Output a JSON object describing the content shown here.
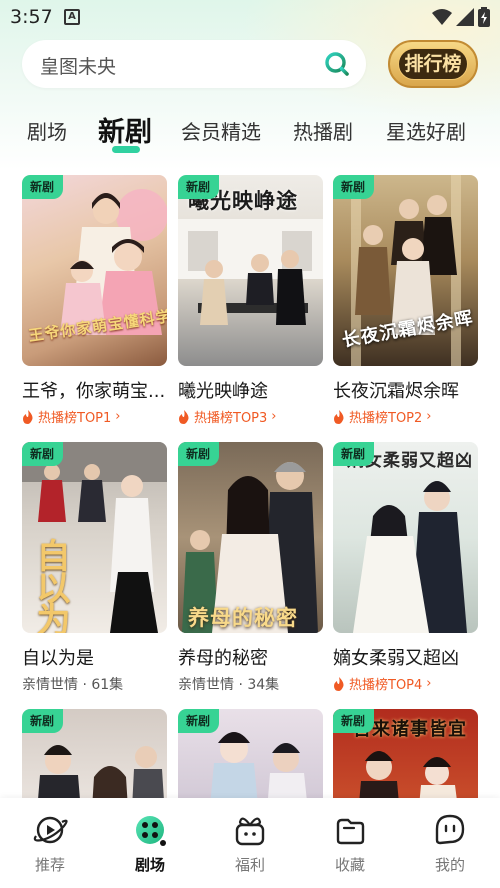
{
  "status_bar": {
    "time": "3:57",
    "notification_icon": "A"
  },
  "search": {
    "placeholder": "皇图未央"
  },
  "rank_button": {
    "label": "排行榜"
  },
  "tabs": [
    {
      "label": "剧场"
    },
    {
      "label": "新剧"
    },
    {
      "label": "会员精选"
    },
    {
      "label": "热播剧"
    },
    {
      "label": "星选好剧"
    }
  ],
  "colors": {
    "accent": "#30d1a0",
    "badge": "#37d394",
    "hot": "#f05a24"
  },
  "cards": [
    {
      "badge": "新剧",
      "poster_text": "王爷你家萌宝懂科学",
      "title": "王爷，你家萌宝...",
      "hot": "热播榜TOP1"
    },
    {
      "badge": "新剧",
      "poster_text": "曦光映峥途",
      "title": "曦光映峥途",
      "hot": "热播榜TOP3"
    },
    {
      "badge": "新剧",
      "poster_text": "长夜沉霜烬余晖",
      "title": "长夜沉霜烬余晖",
      "hot": "热播榜TOP2"
    },
    {
      "badge": "新剧",
      "poster_text": "自以为是",
      "title": "自以为是",
      "sub": "亲情世情 · 61集"
    },
    {
      "badge": "新剧",
      "poster_text": "养母的秘密",
      "title": "养母的秘密",
      "sub": "亲情世情 · 34集"
    },
    {
      "badge": "新剧",
      "poster_text": "嫡女柔弱又超凶",
      "title": "嫡女柔弱又超凶",
      "hot": "热播榜TOP4"
    },
    {
      "badge": "新剧"
    },
    {
      "badge": "新剧"
    },
    {
      "badge": "新剧",
      "poster_text": "吾来诸事皆宜"
    }
  ],
  "nav": [
    {
      "label": "推荐",
      "icon": "planet-play-icon"
    },
    {
      "label": "剧场",
      "icon": "film-reel-icon"
    },
    {
      "label": "福利",
      "icon": "gift-box-icon"
    },
    {
      "label": "收藏",
      "icon": "folder-icon"
    },
    {
      "label": "我的",
      "icon": "profile-face-icon"
    }
  ]
}
